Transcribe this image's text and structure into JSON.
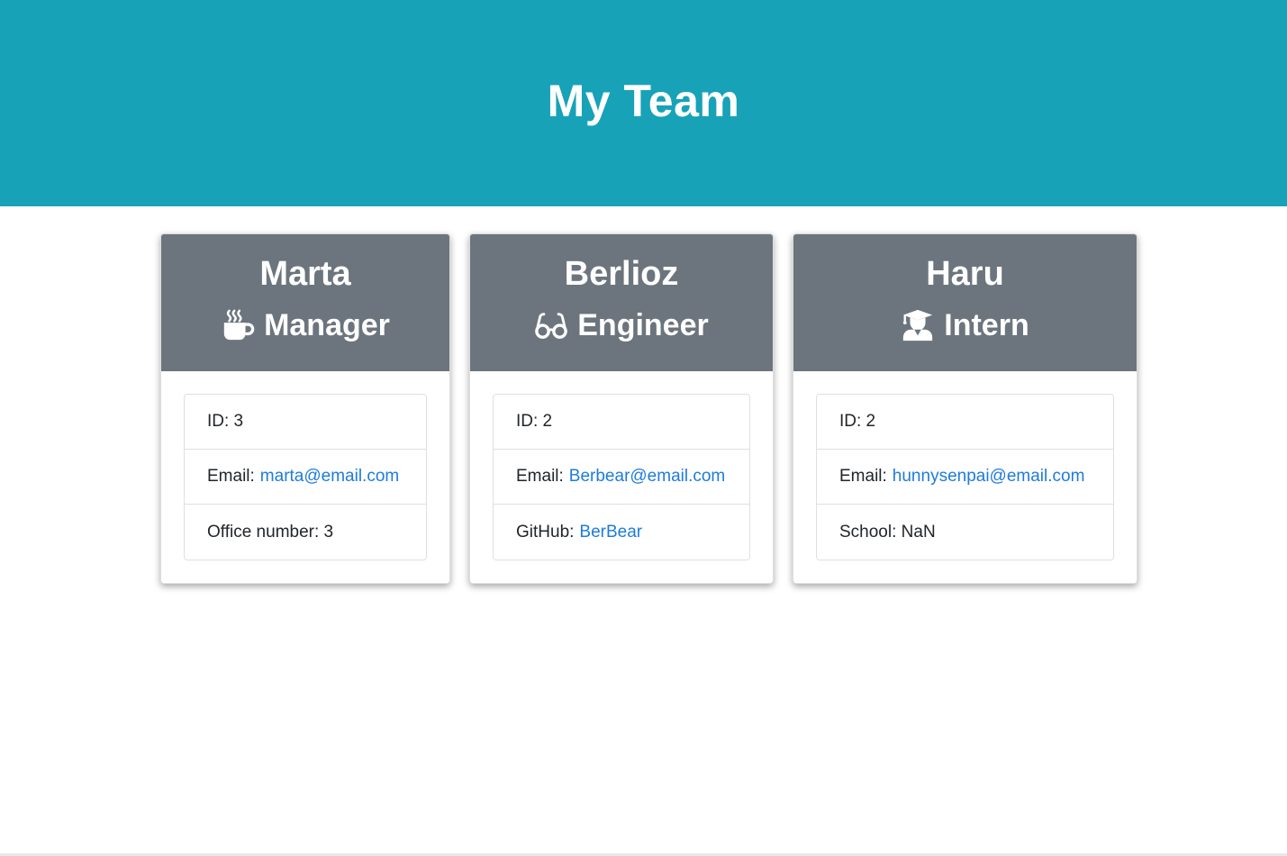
{
  "header": {
    "title": "My Team"
  },
  "cards": [
    {
      "name": "Marta",
      "role": "Manager",
      "icon": "mug-hot-icon",
      "id_text": "ID: 3",
      "email_label": "Email:",
      "email": "marta@email.com",
      "extra_label": "Office number: 3",
      "extra_link": ""
    },
    {
      "name": "Berlioz",
      "role": "Engineer",
      "icon": "glasses-icon",
      "id_text": "ID: 2",
      "email_label": "Email:",
      "email": "Berbear@email.com",
      "extra_label": "GitHub:",
      "extra_link": "BerBear"
    },
    {
      "name": "Haru",
      "role": "Intern",
      "icon": "user-graduate-icon",
      "id_text": "ID: 2",
      "email_label": "Email:",
      "email": "hunnysenpai@email.com",
      "extra_label": "School: NaN",
      "extra_link": ""
    }
  ],
  "colors": {
    "header_bg": "#17a2b8",
    "card_header_bg": "#6c757d",
    "link": "#1e7bdc"
  }
}
